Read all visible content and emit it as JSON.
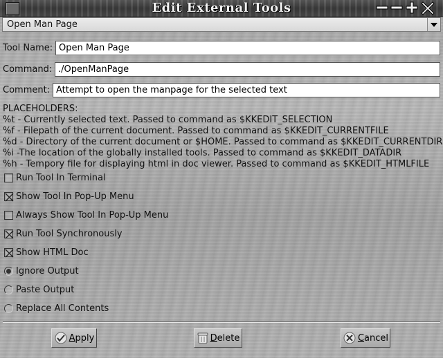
{
  "window": {
    "title": "Edit External Tools"
  },
  "tool_selector": {
    "selected": "Open Man Page"
  },
  "form": {
    "tool_name_label": "Tool Name:",
    "tool_name_value": "Open Man Page",
    "command_label": "Command:",
    "command_value": "./OpenManPage",
    "comment_label": "Comment:",
    "comment_value": "Attempt to open the manpage for the selected text"
  },
  "placeholders": {
    "heading": "PLACEHOLDERS:",
    "lines": [
      "%t - Currently selected text. Passed to command as $KKEDIT_SELECTION",
      "%f - Filepath of the current document. Passed to command as $KKEDIT_CURRENTFILE",
      "%d - Directory of the current document or $HOME. Passed to command as $KKEDIT_CURRENTDIR",
      "%i -The location of the globally installed tools. Passed to command as $KKEDIT_DATADIR",
      "%h - Tempory file for displaying html in doc viewer. Passed to command as $KKEDIT_HTMLFILE"
    ]
  },
  "options": {
    "run_in_terminal": {
      "label": "Run Tool In Terminal",
      "checked": false
    },
    "show_in_popup": {
      "label": "Show Tool In Pop-Up Menu",
      "checked": true
    },
    "always_show_popup": {
      "label": "Always Show Tool In Pop-Up Menu",
      "checked": false
    },
    "run_synchronously": {
      "label": "Run Tool Synchronously",
      "checked": true
    },
    "show_html_doc": {
      "label": "Show HTML Doc",
      "checked": true
    }
  },
  "output_mode": {
    "ignore": {
      "label": "Ignore Output",
      "selected": true
    },
    "paste": {
      "label": "Paste Output",
      "selected": false
    },
    "replace": {
      "label": "Replace All Contents",
      "selected": false
    }
  },
  "buttons": {
    "apply_mnemonic": "A",
    "apply_rest": "pply",
    "delete_mnemonic": "D",
    "delete_rest": "elete",
    "cancel_mnemonic": "C",
    "cancel_rest": "ancel"
  },
  "icons": {
    "window_menu": "window-menu-icon",
    "minimize": "minimize-icon",
    "maximize": "maximize-icon",
    "close": "close-icon",
    "apply": "apply-check-icon",
    "delete": "trash-icon",
    "cancel": "cancel-x-icon"
  }
}
